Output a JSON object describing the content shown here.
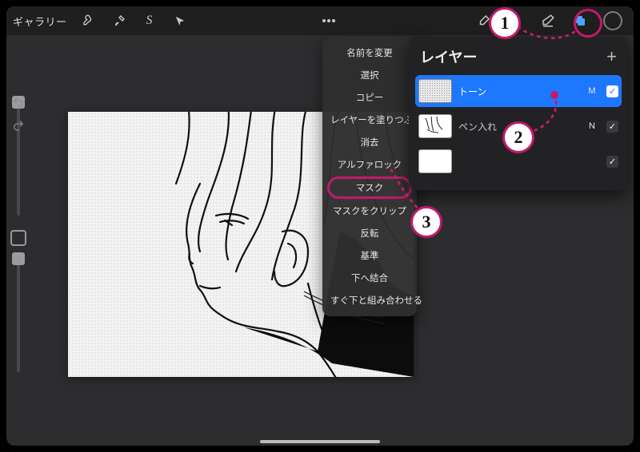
{
  "topbar": {
    "gallery_label": "ギャラリー",
    "icons": {
      "wrench": "wrench-icon",
      "wand": "wand-icon",
      "select_s": "S",
      "arrow": "arrow-icon",
      "more": "more-icon",
      "brush": "brush-icon",
      "smudge": "smudge-icon",
      "eraser": "eraser-icon",
      "layers": "layers-icon",
      "color": "color-circle"
    }
  },
  "context_menu": {
    "items": [
      "名前を変更",
      "選択",
      "コピー",
      "レイヤーを塗りつぶす",
      "消去",
      "アルファロック",
      "マスク",
      "マスクをクリップ",
      "反転",
      "基準",
      "下へ結合",
      "すぐ下と組み合わせる"
    ],
    "highlight_index": 6
  },
  "layers_panel": {
    "title": "レイヤー",
    "plus": "+",
    "rows": [
      {
        "name": "トーン",
        "blend": "M",
        "checked": true,
        "selected": true,
        "thumb": "tone"
      },
      {
        "name": "ペン入れ",
        "blend": "N",
        "checked": true,
        "selected": false,
        "thumb": "line"
      },
      {
        "name": "",
        "blend": "",
        "checked": true,
        "selected": false,
        "thumb": "blank"
      }
    ]
  },
  "callouts": {
    "one": "1",
    "two": "2",
    "three": "3"
  },
  "colors": {
    "accent": "#c11a6b",
    "selection": "#1e78ff"
  }
}
